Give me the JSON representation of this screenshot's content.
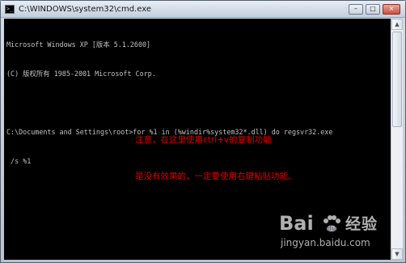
{
  "window": {
    "title": "C:\\WINDOWS\\system32\\cmd.exe",
    "app_icon_glyph": ">_",
    "controls": {
      "minimize": "–",
      "maximize": "□",
      "close": "×"
    }
  },
  "console": {
    "lines": [
      "Microsoft Windows XP [版本 5.1.2600]",
      "(C) 版权所有 1985-2001 Microsoft Corp.",
      "",
      "C:\\Documents and Settings\\root>for %1 in (%windir%system32*.dll) do regsvr32.exe",
      " /s %1"
    ]
  },
  "annotation": {
    "line1": "注意，在这里使用ctrl+v的复制功能",
    "line2": "是没有效果的，一定要使用右键粘贴功能。",
    "color": "#e00000"
  },
  "scrollbar": {
    "up_glyph": "▲",
    "down_glyph": "▼"
  },
  "watermark": {
    "brand_left": "Bai",
    "brand_right": "经验",
    "url": "jingyan.baidu.com"
  },
  "colors": {
    "console_bg": "#000000",
    "console_text": "#c0c0c0",
    "annotation": "#e00000"
  }
}
